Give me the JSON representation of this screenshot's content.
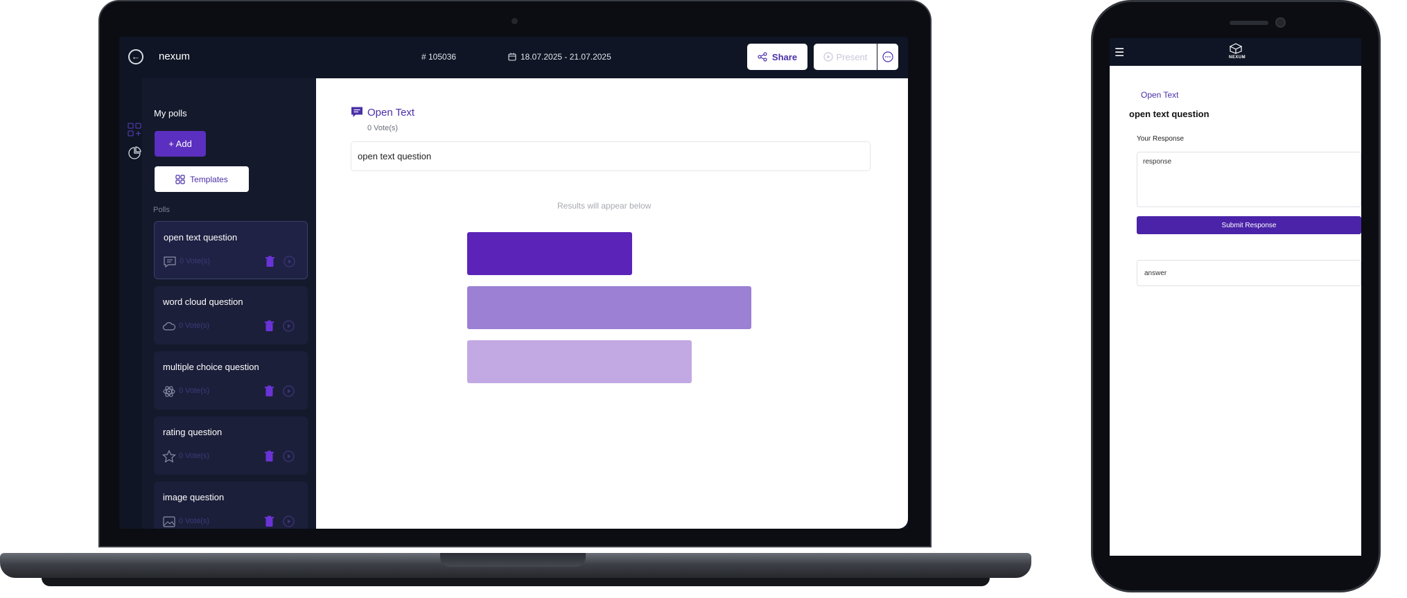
{
  "laptop": {
    "header": {
      "app_name": "nexum",
      "poll_code": "# 105036",
      "date_range": "18.07.2025 - 21.07.2025",
      "share_label": "Share",
      "present_label": "Present"
    },
    "sidebar": {
      "my_polls_label": "My polls",
      "add_label": "+ Add",
      "templates_label": "Templates",
      "polls_section_label": "Polls",
      "polls": [
        {
          "title": "open text question",
          "votes": "0 Vote(s)",
          "icon": "message-icon"
        },
        {
          "title": "word cloud question",
          "votes": "0 Vote(s)",
          "icon": "cloud-icon"
        },
        {
          "title": "multiple choice question",
          "votes": "0 Vote(s)",
          "icon": "atom-icon"
        },
        {
          "title": "rating question",
          "votes": "0 Vote(s)",
          "icon": "star-icon"
        },
        {
          "title": "image question",
          "votes": "0 Vote(s)",
          "icon": "image-icon"
        }
      ]
    },
    "main": {
      "question_type": "Open Text",
      "votes": "0 Vote(s)",
      "question_text": "open text question",
      "results_note": "Results will appear below",
      "bars": [
        {
          "fraction": 0.58,
          "color": "#5b23b8"
        },
        {
          "fraction": 1.0,
          "color": "#9b80d3"
        },
        {
          "fraction": 0.79,
          "color": "#c2a9e4"
        }
      ]
    }
  },
  "phone": {
    "brand": "NEXUM",
    "question_type": "Open Text",
    "question_text": "open text question",
    "response_label": "Your Response",
    "response_value": "response",
    "submit_label": "Submit Response",
    "answer_text": "answer"
  },
  "colors": {
    "accent": "#5b2fbf",
    "header_bg": "#0f1524",
    "sidebar_bg": "#141a2c",
    "card_bg": "#1c1f3a"
  }
}
